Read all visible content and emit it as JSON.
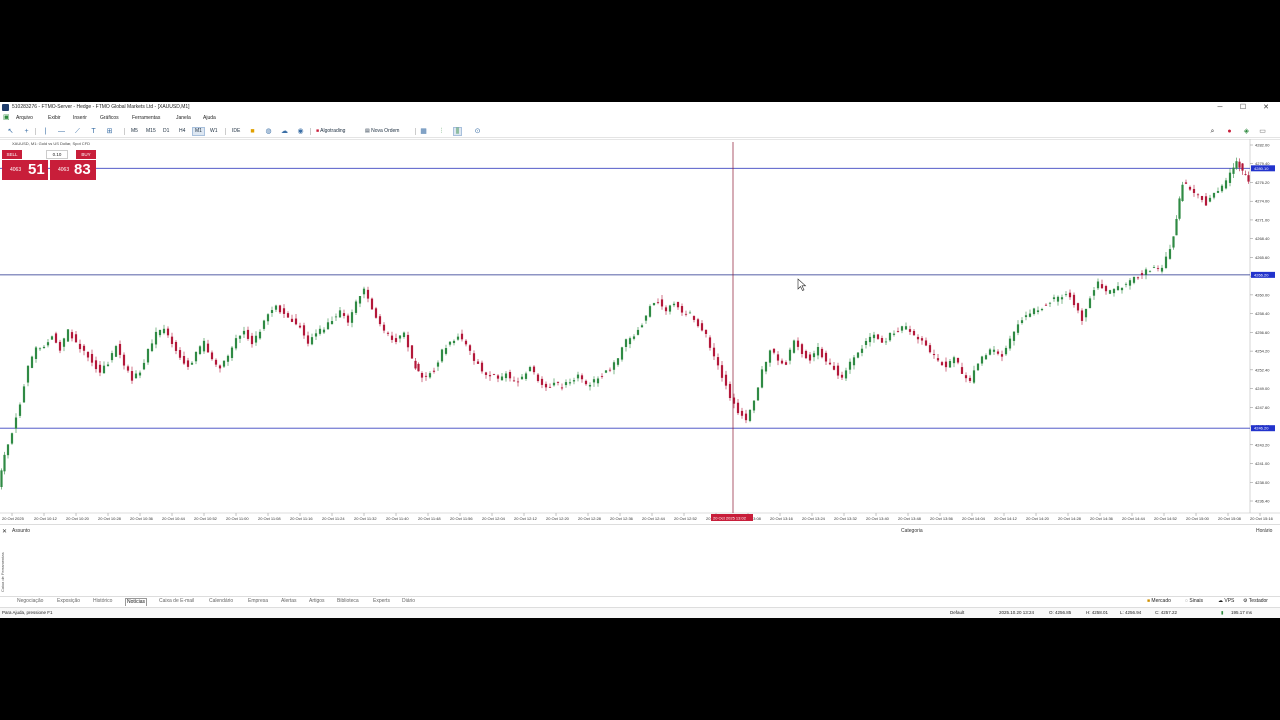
{
  "window": {
    "title": "510283276 - FTMO-Server - Hedge - FTMO Global Markets Ltd - [XAUUSD,M1]",
    "minimize": "─",
    "maximize": "☐",
    "close": "✕"
  },
  "menu": {
    "items": [
      "Arquivo",
      "Exibir",
      "Inserir",
      "Gráficos",
      "Ferramentas",
      "Janela",
      "Ajuda"
    ]
  },
  "toolbar": {
    "timeframes": [
      "M5",
      "M15",
      "D1",
      "H4",
      "M1",
      "W1"
    ],
    "active_timeframe": "M1",
    "ide_label": "IDE",
    "algotrading_label": "Algotrading",
    "new_order_label": "Nova Ordem"
  },
  "chart": {
    "symbol_label": "XAUUSD, M1:  Gold vs US Dollar, Spot CFD",
    "one_click": {
      "sell_label": "SELL",
      "buy_label": "BUY",
      "volume": "0.10",
      "sell_price_small": "4063",
      "sell_price_big": "51",
      "buy_price_small": "4063",
      "buy_price_big": "83"
    },
    "y_ticks": [
      "4282.00",
      "4279.40",
      "4276.20",
      "4274.00",
      "4271.00",
      "4268.40",
      "4265.60",
      "4263.00",
      "4260.00",
      "4258.40",
      "4256.60",
      "4254.20",
      "4252.40",
      "4249.00",
      "4247.60",
      "4245.40",
      "4243.20",
      "4241.00",
      "4238.00",
      "4236.40"
    ],
    "price_tags": [
      {
        "text": "4280.10",
        "value": 4280.1,
        "color": "#2233cc"
      },
      {
        "text": "4266.20",
        "value": 4266.2,
        "color": "#2233cc"
      },
      {
        "text": "4246.20",
        "value": 4246.2,
        "color": "#2233cc"
      }
    ],
    "crosshair_time_label": "20 Oct 2025 13:02",
    "x_ticks": [
      "20 Oct 2025",
      "20 Oct 10:12",
      "20 Oct 10:20",
      "20 Oct 10:28",
      "20 Oct 10:36",
      "20 Oct 10:44",
      "20 Oct 10:52",
      "20 Oct 11:00",
      "20 Oct 11:08",
      "20 Oct 11:16",
      "20 Oct 11:24",
      "20 Oct 11:32",
      "20 Oct 11:40",
      "20 Oct 11:48",
      "20 Oct 11:56",
      "20 Oct 12:04",
      "20 Oct 12:12",
      "20 Oct 12:20",
      "20 Oct 12:28",
      "20 Oct 12:36",
      "20 Oct 12:44",
      "20 Oct 12:52",
      "20 Oct 13:00",
      "20 Oct 13:08",
      "20 Oct 13:16",
      "20 Oct 13:24",
      "20 Oct 13:32",
      "20 Oct 13:40",
      "20 Oct 13:48",
      "20 Oct 13:56",
      "20 Oct 14:04",
      "20 Oct 14:12",
      "20 Oct 14:20",
      "20 Oct 14:28",
      "20 Oct 14:36",
      "20 Oct 14:44",
      "20 Oct 14:52",
      "20 Oct 15:00",
      "20 Oct 15:08",
      "20 Oct 15:16"
    ]
  },
  "chart_data": {
    "type": "candlestick",
    "ylim": [
      4235.4,
      4283.4
    ],
    "bull_color": "#2f8a44",
    "bear_color": "#b3183a",
    "levels": [
      4280.1,
      4266.2,
      4246.2
    ],
    "points": [
      [
        0,
        4238.2
      ],
      [
        6,
        4242.5
      ],
      [
        14,
        4245.8
      ],
      [
        22,
        4249.5
      ],
      [
        30,
        4254.2
      ],
      [
        38,
        4256.8
      ],
      [
        46,
        4257.1
      ],
      [
        54,
        4258.4
      ],
      [
        62,
        4256.6
      ],
      [
        70,
        4258.9
      ],
      [
        78,
        4257.4
      ],
      [
        86,
        4256.3
      ],
      [
        94,
        4255.1
      ],
      [
        102,
        4253.4
      ],
      [
        110,
        4254.8
      ],
      [
        118,
        4256.9
      ],
      [
        126,
        4254.6
      ],
      [
        134,
        4252.4
      ],
      [
        142,
        4253.8
      ],
      [
        150,
        4256.2
      ],
      [
        158,
        4258.5
      ],
      [
        166,
        4259.1
      ],
      [
        174,
        4257.2
      ],
      [
        182,
        4255.5
      ],
      [
        190,
        4254.3
      ],
      [
        198,
        4255.8
      ],
      [
        206,
        4257.3
      ],
      [
        214,
        4255.2
      ],
      [
        222,
        4254.1
      ],
      [
        230,
        4255.6
      ],
      [
        238,
        4257.9
      ],
      [
        246,
        4258.8
      ],
      [
        254,
        4257.1
      ],
      [
        262,
        4258.9
      ],
      [
        270,
        4261.1
      ],
      [
        278,
        4262.3
      ],
      [
        286,
        4260.9
      ],
      [
        294,
        4260.2
      ],
      [
        302,
        4259.6
      ],
      [
        310,
        4257.4
      ],
      [
        318,
        4258.6
      ],
      [
        326,
        4259.2
      ],
      [
        334,
        4260.5
      ],
      [
        342,
        4261.4
      ],
      [
        350,
        4259.8
      ],
      [
        358,
        4262.6
      ],
      [
        366,
        4264.1
      ],
      [
        374,
        4261.7
      ],
      [
        382,
        4259.5
      ],
      [
        390,
        4258.2
      ],
      [
        398,
        4257.6
      ],
      [
        406,
        4258.4
      ],
      [
        414,
        4255.1
      ],
      [
        420,
        4253.5
      ],
      [
        428,
        4252.8
      ],
      [
        436,
        4253.9
      ],
      [
        444,
        4256.2
      ],
      [
        452,
        4257.4
      ],
      [
        460,
        4258.3
      ],
      [
        468,
        4256.9
      ],
      [
        476,
        4255.1
      ],
      [
        484,
        4253.8
      ],
      [
        492,
        4253.1
      ],
      [
        500,
        4252.6
      ],
      [
        508,
        4253.4
      ],
      [
        516,
        4252.1
      ],
      [
        524,
        4252.8
      ],
      [
        532,
        4253.9
      ],
      [
        540,
        4252.6
      ],
      [
        548,
        4251.3
      ],
      [
        556,
        4252.0
      ],
      [
        564,
        4251.6
      ],
      [
        572,
        4252.4
      ],
      [
        580,
        4252.9
      ],
      [
        588,
        4251.7
      ],
      [
        596,
        4252.3
      ],
      [
        604,
        4253.2
      ],
      [
        612,
        4254.1
      ],
      [
        620,
        4255.4
      ],
      [
        628,
        4257.5
      ],
      [
        636,
        4258.3
      ],
      [
        644,
        4259.9
      ],
      [
        652,
        4262.1
      ],
      [
        660,
        4262.9
      ],
      [
        668,
        4261.5
      ],
      [
        676,
        4262.7
      ],
      [
        684,
        4261.4
      ],
      [
        692,
        4261.0
      ],
      [
        700,
        4259.8
      ],
      [
        708,
        4258.2
      ],
      [
        716,
        4255.6
      ],
      [
        724,
        4253.1
      ],
      [
        732,
        4250.2
      ],
      [
        740,
        4248.4
      ],
      [
        748,
        4247.1
      ],
      [
        756,
        4249.7
      ],
      [
        764,
        4253.6
      ],
      [
        772,
        4256.4
      ],
      [
        780,
        4255.1
      ],
      [
        788,
        4254.7
      ],
      [
        796,
        4257.8
      ],
      [
        804,
        4256.1
      ],
      [
        812,
        4255.2
      ],
      [
        820,
        4256.6
      ],
      [
        828,
        4254.9
      ],
      [
        836,
        4254.1
      ],
      [
        844,
        4252.7
      ],
      [
        852,
        4254.6
      ],
      [
        860,
        4256.1
      ],
      [
        868,
        4257.4
      ],
      [
        876,
        4258.2
      ],
      [
        884,
        4257.1
      ],
      [
        892,
        4258.6
      ],
      [
        900,
        4259.0
      ],
      [
        908,
        4259.3
      ],
      [
        916,
        4258.4
      ],
      [
        924,
        4257.3
      ],
      [
        932,
        4256.2
      ],
      [
        940,
        4255.0
      ],
      [
        948,
        4254.3
      ],
      [
        956,
        4255.6
      ],
      [
        964,
        4253.4
      ],
      [
        972,
        4252.3
      ],
      [
        980,
        4254.7
      ],
      [
        988,
        4255.9
      ],
      [
        996,
        4256.4
      ],
      [
        1004,
        4255.8
      ],
      [
        1012,
        4257.6
      ],
      [
        1020,
        4259.9
      ],
      [
        1028,
        4260.8
      ],
      [
        1036,
        4261.6
      ],
      [
        1044,
        4262.1
      ],
      [
        1052,
        4262.8
      ],
      [
        1060,
        4263.3
      ],
      [
        1068,
        4263.9
      ],
      [
        1076,
        4262.6
      ],
      [
        1084,
        4260.4
      ],
      [
        1092,
        4263.2
      ],
      [
        1100,
        4265.1
      ],
      [
        1108,
        4263.8
      ],
      [
        1116,
        4264.3
      ],
      [
        1124,
        4264.7
      ],
      [
        1132,
        4265.5
      ],
      [
        1140,
        4266.1
      ],
      [
        1148,
        4266.6
      ],
      [
        1156,
        4267.1
      ],
      [
        1164,
        4266.8
      ],
      [
        1172,
        4269.7
      ],
      [
        1178,
        4273.4
      ],
      [
        1184,
        4278.3
      ],
      [
        1192,
        4277.2
      ],
      [
        1200,
        4276.8
      ],
      [
        1208,
        4275.6
      ],
      [
        1216,
        4276.9
      ],
      [
        1224,
        4277.8
      ],
      [
        1232,
        4279.2
      ],
      [
        1238,
        4281.3
      ],
      [
        1244,
        4279.6
      ],
      [
        1250,
        4278.4
      ]
    ]
  },
  "toolbox": {
    "col_subject": "Assunto",
    "col_category": "Categoria",
    "col_time": "Horário",
    "vertical_label": "Caixa de Ferramentas",
    "close": "✕"
  },
  "tabs": [
    "Negociação",
    "Exposição",
    "Histórico",
    "Notícias",
    "Caixa de E-mail",
    "Calendário",
    "Empresa",
    "Alertas",
    "Artigos",
    "Biblioteca",
    "Experts",
    "Diário"
  ],
  "active_tab": "Notícias",
  "tabs_right": [
    "Mercado",
    "Sinais",
    "VPS",
    "Testador"
  ],
  "status": {
    "help": "Para Ajuda, pressione F1",
    "profile": "Default",
    "datetime": "2025.10.20 13:24",
    "open": "O: 4256.85",
    "high": "H: 4258.01",
    "low": "L: 4256.94",
    "close": "C: 4257.22",
    "ping": "195.17 ms"
  }
}
